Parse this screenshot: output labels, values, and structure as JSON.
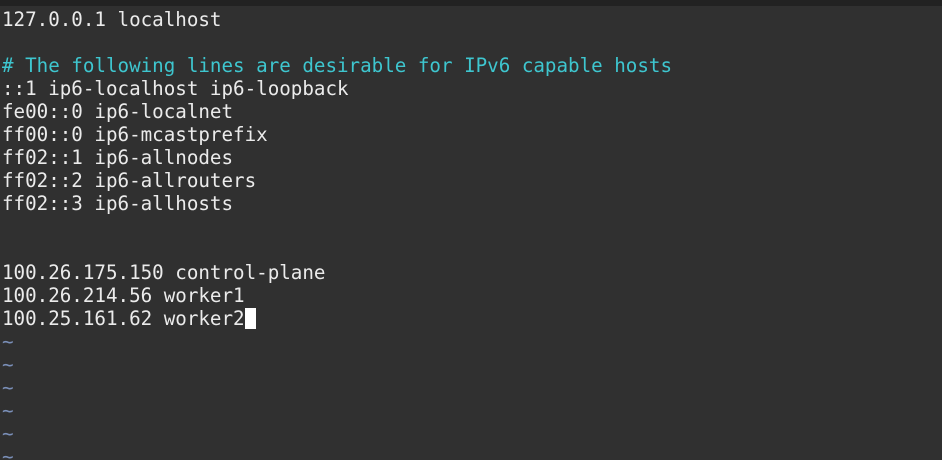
{
  "editor": {
    "lines": [
      {
        "text": "127.0.0.1 localhost",
        "type": "text"
      },
      {
        "text": "",
        "type": "text"
      },
      {
        "text": "# The following lines are desirable for IPv6 capable hosts",
        "type": "comment"
      },
      {
        "text": "::1 ip6-localhost ip6-loopback",
        "type": "text"
      },
      {
        "text": "fe00::0 ip6-localnet",
        "type": "text"
      },
      {
        "text": "ff00::0 ip6-mcastprefix",
        "type": "text"
      },
      {
        "text": "ff02::1 ip6-allnodes",
        "type": "text"
      },
      {
        "text": "ff02::2 ip6-allrouters",
        "type": "text"
      },
      {
        "text": "ff02::3 ip6-allhosts",
        "type": "text"
      },
      {
        "text": "",
        "type": "text"
      },
      {
        "text": "",
        "type": "text"
      },
      {
        "text": "100.26.175.150 control-plane",
        "type": "text"
      },
      {
        "text": "100.26.214.56 worker1",
        "type": "text"
      },
      {
        "text": "100.25.161.62 worker2",
        "type": "text",
        "cursor": true
      },
      {
        "text": "~",
        "type": "tilde"
      },
      {
        "text": "~",
        "type": "tilde"
      },
      {
        "text": "~",
        "type": "tilde"
      },
      {
        "text": "~",
        "type": "tilde"
      },
      {
        "text": "~",
        "type": "tilde"
      },
      {
        "text": "~",
        "type": "tilde"
      }
    ]
  },
  "colors": {
    "background": "#303030",
    "text": "#ebebeb",
    "comment": "#3ec6cf",
    "tilde": "#7a8fb8",
    "cursor": "#ffffff"
  }
}
